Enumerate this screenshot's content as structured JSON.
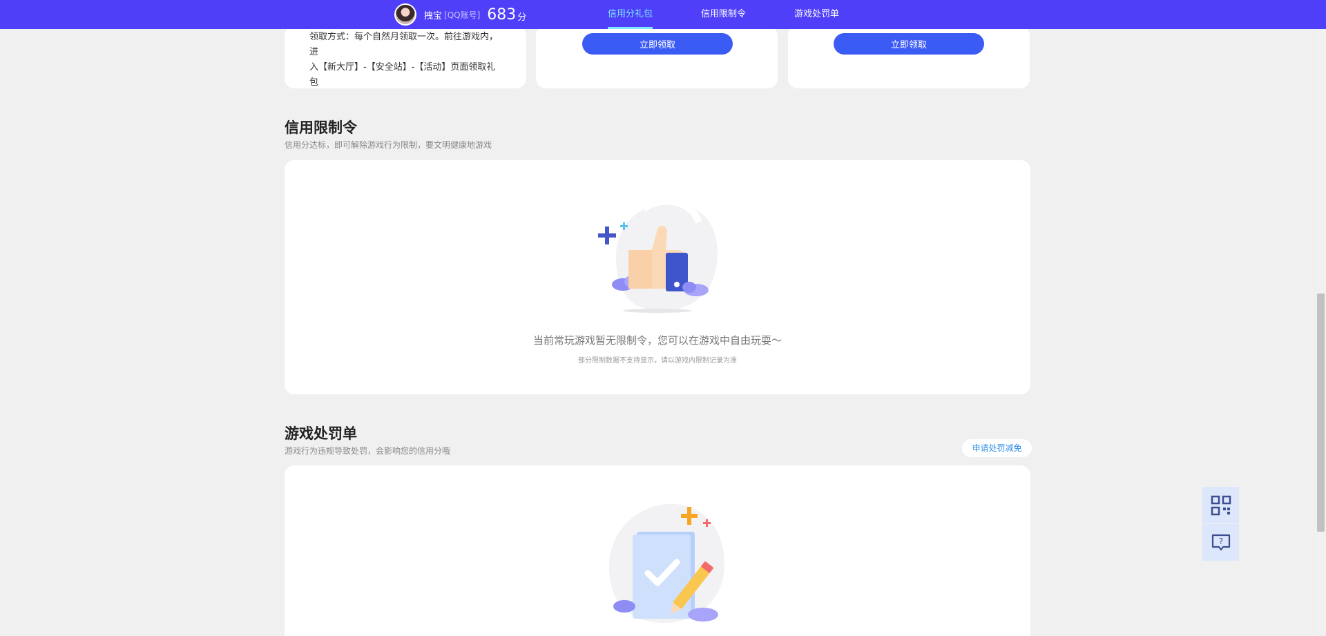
{
  "header": {
    "user_name": "拽宝",
    "account_type": "[QQ账号]",
    "score": "683",
    "score_unit": "分",
    "nav": [
      "信用分礼包",
      "信用限制令",
      "游戏处罚单"
    ],
    "active_nav_color": "#7ee8ff",
    "bar_color": "#4f3ff8"
  },
  "gift_cards": {
    "desc_line1": "领取方式：每个自然月领取一次。前往游戏内，进",
    "desc_line2": "入【新大厅】-【安全站】-【活动】页面领取礼包",
    "claim_label": "立即领取"
  },
  "restriction": {
    "title": "信用限制令",
    "subtitle": "信用分达标，即可解除游戏行为限制，要文明健康地游戏",
    "empty_title": "当前常玩游戏暂无限制令，您可以在游戏中自由玩耍～",
    "empty_note": "部分限制数据不支持显示，请以游戏内限制记录为准"
  },
  "penalty": {
    "title": "游戏处罚单",
    "subtitle": "游戏行为违规导致处罚，会影响您的信用分哦",
    "appeal_label": "申请处罚减免"
  },
  "side_tools": {
    "qr": "qr-code-icon",
    "help": "help-chat-icon"
  }
}
